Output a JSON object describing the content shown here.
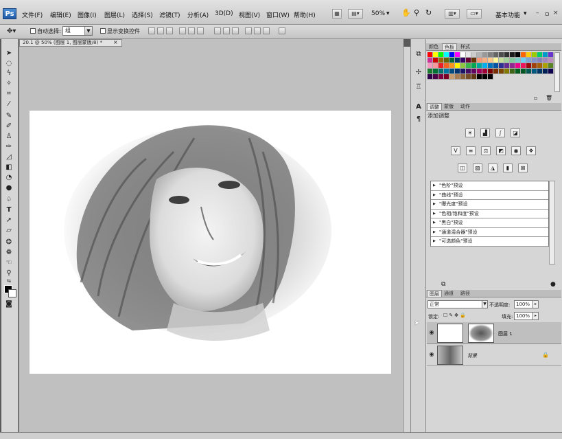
{
  "app": {
    "logo": "Ps",
    "zoom": "50%",
    "workspace": "基本功能",
    "window_controls": [
      "–",
      "ㅁ",
      "×"
    ]
  },
  "menu": [
    "文件(F)",
    "编辑(E)",
    "图像(I)",
    "图层(L)",
    "选择(S)",
    "滤镜(T)",
    "分析(A)",
    "3D(D)",
    "视图(V)",
    "窗口(W)",
    "帮助(H)"
  ],
  "options": {
    "auto_select_label": "自动选择:",
    "auto_select_value": "组",
    "show_transform_label": "显示变换控件"
  },
  "document": {
    "tab_title": "20.1 @ 50% (图层 1, 图层蒙版/8) *",
    "close": "×"
  },
  "panels": {
    "color_tabs": [
      "颜色",
      "色板",
      "样式"
    ],
    "adjust_tabs": [
      "调整",
      "蒙版",
      "动作"
    ],
    "adjust_title": "添加调整",
    "presets": [
      "\"色阶\"预设",
      "\"曲线\"预设",
      "\"曝光度\"预设",
      "\"色相/饱和度\"预设",
      "\"黑白\"预设",
      "\"通道混合器\"预设",
      "\"可选颜色\"预设"
    ],
    "layer_tabs": [
      "图层",
      "通道",
      "路径"
    ],
    "blend_mode": "正常",
    "opacity_label": "不透明度:",
    "opacity_value": "100%",
    "lock_label": "锁定:",
    "fill_label": "填充:",
    "fill_value": "100%",
    "layers": [
      {
        "name": "图层 1",
        "selected": true
      },
      {
        "name": "背景",
        "selected": false
      }
    ]
  },
  "swatch_colors": [
    "#ff0000",
    "#ffff00",
    "#00ff00",
    "#00ffff",
    "#0000ff",
    "#ff00ff",
    "#ffffff",
    "#e6e6e6",
    "#cccccc",
    "#b3b3b3",
    "#999999",
    "#808080",
    "#666666",
    "#4d4d4d",
    "#333333",
    "#1a1a1a",
    "#000000",
    "#ff6600",
    "#ffcc00",
    "#99cc00",
    "#00cc66",
    "#0099cc",
    "#6633cc",
    "#cc3399",
    "#cc0000",
    "#996600",
    "#666600",
    "#006633",
    "#003366",
    "#330066",
    "#660033",
    "#663300",
    "#f7977a",
    "#f9ad81",
    "#fdc68a",
    "#fff79a",
    "#c4df9b",
    "#a2d39c",
    "#82ca9d",
    "#7bcdc8",
    "#6ecff6",
    "#7ea7d8",
    "#8493ca",
    "#8882be",
    "#a187be",
    "#bc8dbf",
    "#f49ac2",
    "#f6989d",
    "#ed1c24",
    "#f26522",
    "#f7941d",
    "#fff200",
    "#8dc63f",
    "#39b54a",
    "#00a651",
    "#00a99d",
    "#00aeef",
    "#0072bc",
    "#0054a6",
    "#2e3192",
    "#662d91",
    "#92278f",
    "#ec008c",
    "#ed145b",
    "#9e0b0f",
    "#a0410d",
    "#a36209",
    "#aba000",
    "#598527",
    "#1a7b30",
    "#007236",
    "#00746b",
    "#0076a3",
    "#004b80",
    "#003471",
    "#1b1464",
    "#440e62",
    "#630460",
    "#9e005d",
    "#9e0039",
    "#790000",
    "#7b2e00",
    "#7d4900",
    "#827b00",
    "#406618",
    "#005e20",
    "#005826",
    "#005952",
    "#005b7f",
    "#003663",
    "#002157",
    "#0d004c",
    "#32004b",
    "#4b0049",
    "#7b0046",
    "#7a0026",
    "#c69c6d",
    "#a67c52",
    "#8c6239",
    "#754c24",
    "#603913",
    "#000000",
    "#000000",
    "#000000"
  ]
}
